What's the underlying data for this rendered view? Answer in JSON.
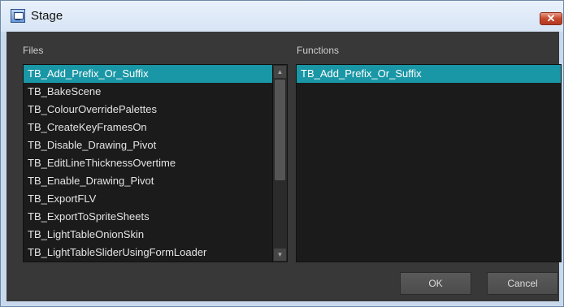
{
  "window": {
    "title": "Stage",
    "close_glyph": "✕"
  },
  "files": {
    "label": "Files",
    "items": [
      "TB_Add_Prefix_Or_Suffix",
      "TB_BakeScene",
      "TB_ColourOverridePalettes",
      "TB_CreateKeyFramesOn",
      "TB_Disable_Drawing_Pivot",
      "TB_EditLineThicknessOvertime",
      "TB_Enable_Drawing_Pivot",
      "TB_ExportFLV",
      "TB_ExportToSpriteSheets",
      "TB_LightTableOnionSkin",
      "TB_LightTableSliderUsingFormLoader"
    ],
    "selected_index": 0,
    "scroll_up_icon": "triangle-up-icon",
    "scroll_down_icon": "triangle-down-icon"
  },
  "functions": {
    "label": "Functions",
    "items": [
      "TB_Add_Prefix_Or_Suffix"
    ],
    "selected_index": 0
  },
  "buttons": {
    "ok_label": "OK",
    "cancel_label": "Cancel"
  },
  "colors": {
    "selection": "#1a97a6",
    "panel_background": "#383838",
    "list_background": "#1b1b1b",
    "close_button": "#c5482d"
  }
}
